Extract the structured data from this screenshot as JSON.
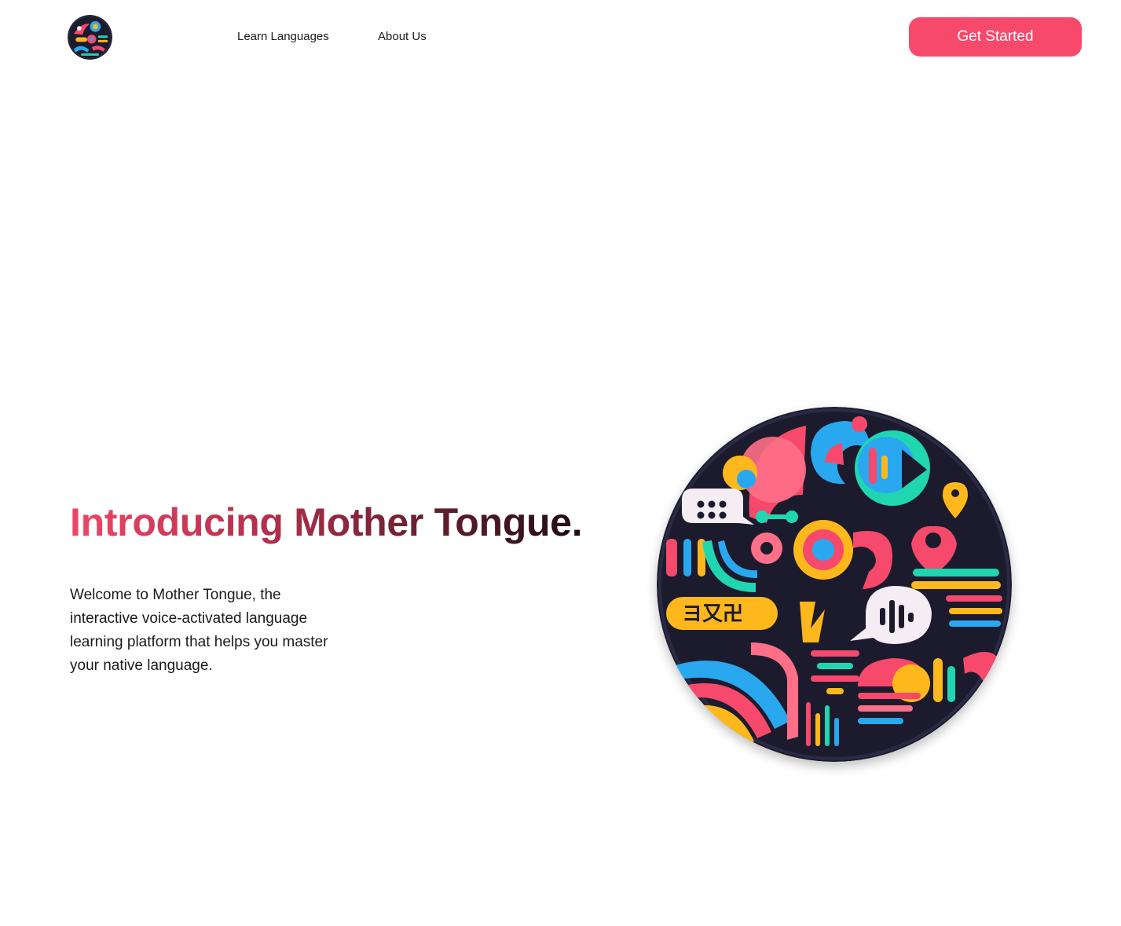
{
  "nav": {
    "logo_icon": "mother-tongue-logo-icon",
    "links": [
      {
        "label": "Learn Languages"
      },
      {
        "label": "About Us"
      }
    ],
    "cta_label": "Get Started"
  },
  "hero": {
    "title": "Introducing Mother Tongue.",
    "description": "Welcome to Mother Tongue, the interactive voice-activated language learning platform that helps you master your native language.",
    "artwork_icon": "language-mosaic-illustration"
  },
  "colors": {
    "accent": "#f6496b",
    "art_background": "#1c1b2e",
    "art_pink": "#f6496b",
    "art_blue": "#29a8f0",
    "art_teal": "#20d6b0",
    "art_yellow": "#ffb81c"
  }
}
